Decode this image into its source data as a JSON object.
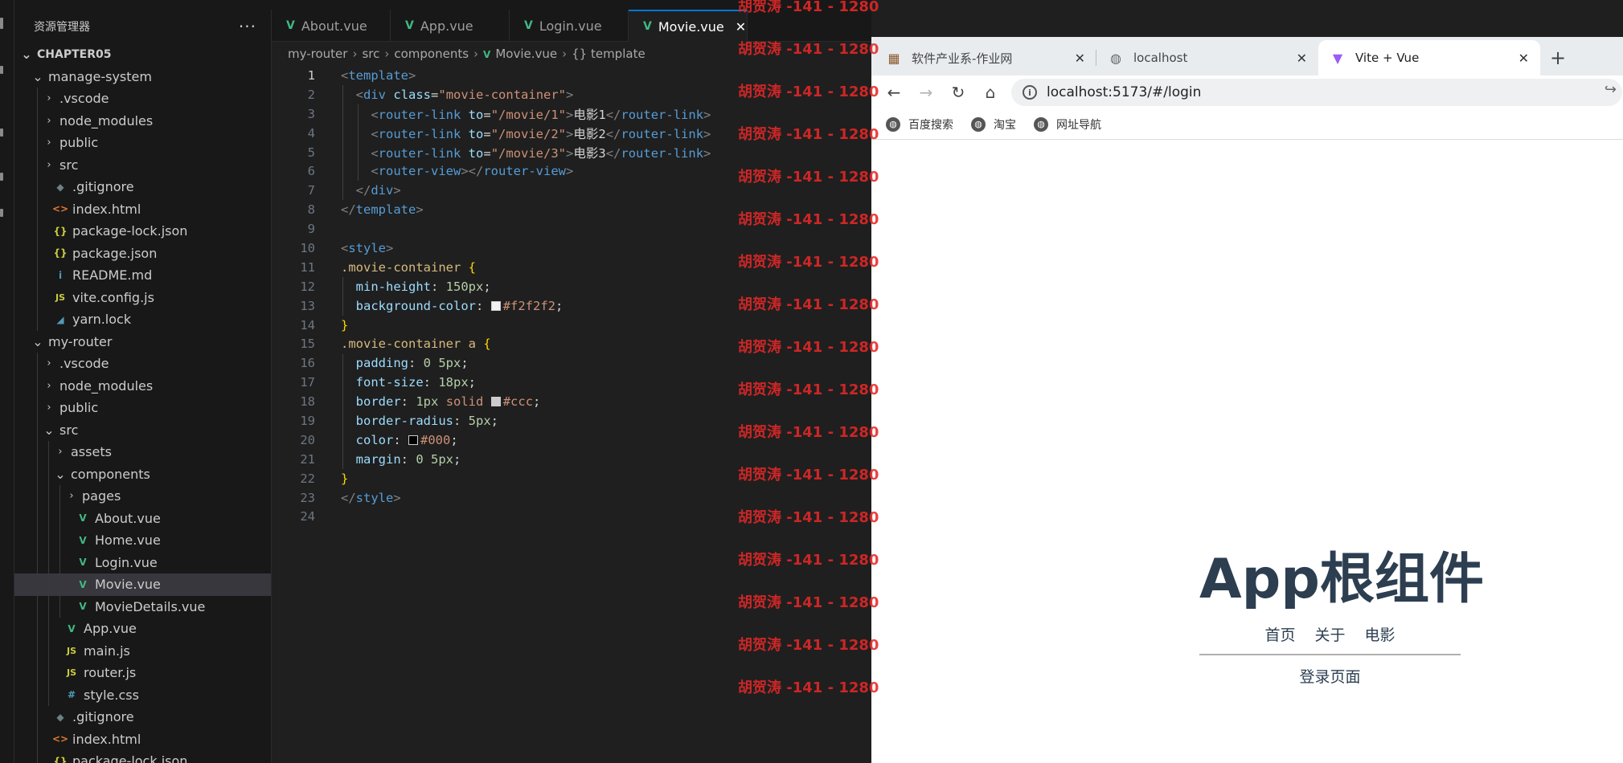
{
  "vscode": {
    "explorer_title": "资源管理器",
    "more_label": "···",
    "tree": [
      {
        "label": "CHAPTER05",
        "depth": 0,
        "kind": "folder-open",
        "icon": "",
        "bold": true
      },
      {
        "label": "manage-system",
        "depth": 1,
        "kind": "folder-open",
        "icon": ""
      },
      {
        "label": ".vscode",
        "depth": 2,
        "kind": "folder",
        "icon": ""
      },
      {
        "label": "node_modules",
        "depth": 2,
        "kind": "folder",
        "icon": ""
      },
      {
        "label": "public",
        "depth": 2,
        "kind": "folder",
        "icon": ""
      },
      {
        "label": "src",
        "depth": 2,
        "kind": "folder",
        "icon": ""
      },
      {
        "label": ".gitignore",
        "depth": 2,
        "kind": "file",
        "icon": "git"
      },
      {
        "label": "index.html",
        "depth": 2,
        "kind": "file",
        "icon": "html"
      },
      {
        "label": "package-lock.json",
        "depth": 2,
        "kind": "file",
        "icon": "json"
      },
      {
        "label": "package.json",
        "depth": 2,
        "kind": "file",
        "icon": "json"
      },
      {
        "label": "README.md",
        "depth": 2,
        "kind": "file",
        "icon": "info"
      },
      {
        "label": "vite.config.js",
        "depth": 2,
        "kind": "file",
        "icon": "js"
      },
      {
        "label": "yarn.lock",
        "depth": 2,
        "kind": "file",
        "icon": "yarn"
      },
      {
        "label": "my-router",
        "depth": 1,
        "kind": "folder-open",
        "icon": ""
      },
      {
        "label": ".vscode",
        "depth": 2,
        "kind": "folder",
        "icon": ""
      },
      {
        "label": "node_modules",
        "depth": 2,
        "kind": "folder",
        "icon": ""
      },
      {
        "label": "public",
        "depth": 2,
        "kind": "folder",
        "icon": ""
      },
      {
        "label": "src",
        "depth": 2,
        "kind": "folder-open",
        "icon": ""
      },
      {
        "label": "assets",
        "depth": 3,
        "kind": "folder",
        "icon": ""
      },
      {
        "label": "components",
        "depth": 3,
        "kind": "folder-open",
        "icon": ""
      },
      {
        "label": "pages",
        "depth": 4,
        "kind": "folder",
        "icon": ""
      },
      {
        "label": "About.vue",
        "depth": 4,
        "kind": "file",
        "icon": "vue"
      },
      {
        "label": "Home.vue",
        "depth": 4,
        "kind": "file",
        "icon": "vue"
      },
      {
        "label": "Login.vue",
        "depth": 4,
        "kind": "file",
        "icon": "vue"
      },
      {
        "label": "Movie.vue",
        "depth": 4,
        "kind": "file",
        "icon": "vue",
        "selected": true
      },
      {
        "label": "MovieDetails.vue",
        "depth": 4,
        "kind": "file",
        "icon": "vue"
      },
      {
        "label": "App.vue",
        "depth": 3,
        "kind": "file",
        "icon": "vue"
      },
      {
        "label": "main.js",
        "depth": 3,
        "kind": "file",
        "icon": "js"
      },
      {
        "label": "router.js",
        "depth": 3,
        "kind": "file",
        "icon": "js"
      },
      {
        "label": "style.css",
        "depth": 3,
        "kind": "file",
        "icon": "css"
      },
      {
        "label": ".gitignore",
        "depth": 2,
        "kind": "file",
        "icon": "git"
      },
      {
        "label": "index.html",
        "depth": 2,
        "kind": "file",
        "icon": "html"
      },
      {
        "label": "package-lock.json",
        "depth": 2,
        "kind": "file",
        "icon": "json"
      }
    ],
    "tabs": [
      {
        "label": "About.vue",
        "active": false
      },
      {
        "label": "App.vue",
        "active": false
      },
      {
        "label": "Login.vue",
        "active": false
      },
      {
        "label": "Movie.vue",
        "active": true
      }
    ],
    "tab_close": "✕",
    "breadcrumb": [
      "my-router",
      "src",
      "components",
      "Movie.vue",
      "{} template"
    ],
    "current_line": 1,
    "code": [
      [
        [
          "t-brk",
          "<"
        ],
        [
          "t-tag",
          "template"
        ],
        [
          "t-brk",
          ">"
        ]
      ],
      [
        [
          "",
          "  "
        ],
        [
          "t-brk",
          "<"
        ],
        [
          "t-tag",
          "div"
        ],
        [
          "",
          " "
        ],
        [
          "t-attr",
          "class"
        ],
        [
          "",
          "="
        ],
        [
          "t-str",
          "\"movie-container\""
        ],
        [
          "t-brk",
          ">"
        ]
      ],
      [
        [
          "",
          "    "
        ],
        [
          "t-brk",
          "<"
        ],
        [
          "t-tag",
          "router-link"
        ],
        [
          "",
          " "
        ],
        [
          "t-attr",
          "to"
        ],
        [
          "",
          "="
        ],
        [
          "t-str",
          "\"/movie/1\""
        ],
        [
          "t-brk",
          ">"
        ],
        [
          "",
          "电影1"
        ],
        [
          "t-brk",
          "</"
        ],
        [
          "t-tag",
          "router-link"
        ],
        [
          "t-brk",
          ">"
        ]
      ],
      [
        [
          "",
          "    "
        ],
        [
          "t-brk",
          "<"
        ],
        [
          "t-tag",
          "router-link"
        ],
        [
          "",
          " "
        ],
        [
          "t-attr",
          "to"
        ],
        [
          "",
          "="
        ],
        [
          "t-str",
          "\"/movie/2\""
        ],
        [
          "t-brk",
          ">"
        ],
        [
          "",
          "电影2"
        ],
        [
          "t-brk",
          "</"
        ],
        [
          "t-tag",
          "router-link"
        ],
        [
          "t-brk",
          ">"
        ]
      ],
      [
        [
          "",
          "    "
        ],
        [
          "t-brk",
          "<"
        ],
        [
          "t-tag",
          "router-link"
        ],
        [
          "",
          " "
        ],
        [
          "t-attr",
          "to"
        ],
        [
          "",
          "="
        ],
        [
          "t-str",
          "\"/movie/3\""
        ],
        [
          "t-brk",
          ">"
        ],
        [
          "",
          "电影3"
        ],
        [
          "t-brk",
          "</"
        ],
        [
          "t-tag",
          "router-link"
        ],
        [
          "t-brk",
          ">"
        ]
      ],
      [
        [
          "",
          "    "
        ],
        [
          "t-brk",
          "<"
        ],
        [
          "t-tag",
          "router-view"
        ],
        [
          "t-brk",
          "></"
        ],
        [
          "t-tag",
          "router-view"
        ],
        [
          "t-brk",
          ">"
        ]
      ],
      [
        [
          "",
          "  "
        ],
        [
          "t-brk",
          "</"
        ],
        [
          "t-tag",
          "div"
        ],
        [
          "t-brk",
          ">"
        ]
      ],
      [
        [
          "t-brk",
          "</"
        ],
        [
          "t-tag",
          "template"
        ],
        [
          "t-brk",
          ">"
        ]
      ],
      [],
      [
        [
          "t-brk",
          "<"
        ],
        [
          "t-tag",
          "style"
        ],
        [
          "t-brk",
          ">"
        ]
      ],
      [
        [
          "t-sel",
          ".movie-container"
        ],
        [
          "",
          " "
        ],
        [
          "t-brace",
          "{"
        ]
      ],
      [
        [
          "",
          "  "
        ],
        [
          "t-prop",
          "min-height"
        ],
        [
          "",
          ": "
        ],
        [
          "t-num",
          "150px"
        ],
        [
          "",
          ";"
        ]
      ],
      [
        [
          "",
          "  "
        ],
        [
          "t-prop",
          "background-color"
        ],
        [
          "",
          ": "
        ],
        [
          "swatch",
          "#f2f2f2"
        ],
        [
          "t-val",
          "#f2f2f2"
        ],
        [
          "",
          ";"
        ]
      ],
      [
        [
          "t-brace",
          "}"
        ]
      ],
      [
        [
          "t-sel",
          ".movie-container a"
        ],
        [
          "",
          " "
        ],
        [
          "t-brace",
          "{"
        ]
      ],
      [
        [
          "",
          "  "
        ],
        [
          "t-prop",
          "padding"
        ],
        [
          "",
          ": "
        ],
        [
          "t-num",
          "0 5px"
        ],
        [
          "",
          ";"
        ]
      ],
      [
        [
          "",
          "  "
        ],
        [
          "t-prop",
          "font-size"
        ],
        [
          "",
          ": "
        ],
        [
          "t-num",
          "18px"
        ],
        [
          "",
          ";"
        ]
      ],
      [
        [
          "",
          "  "
        ],
        [
          "t-prop",
          "border"
        ],
        [
          "",
          ": "
        ],
        [
          "t-num",
          "1px"
        ],
        [
          "",
          " "
        ],
        [
          "t-val",
          "solid"
        ],
        [
          "",
          " "
        ],
        [
          "swatch",
          "#cccccc"
        ],
        [
          "t-val",
          "#ccc"
        ],
        [
          "",
          ";"
        ]
      ],
      [
        [
          "",
          "  "
        ],
        [
          "t-prop",
          "border-radius"
        ],
        [
          "",
          ": "
        ],
        [
          "t-num",
          "5px"
        ],
        [
          "",
          ";"
        ]
      ],
      [
        [
          "",
          "  "
        ],
        [
          "t-prop",
          "color"
        ],
        [
          "",
          ": "
        ],
        [
          "swatch",
          "#000000"
        ],
        [
          "t-val",
          "#000"
        ],
        [
          "",
          ";"
        ]
      ],
      [
        [
          "",
          "  "
        ],
        [
          "t-prop",
          "margin"
        ],
        [
          "",
          ": "
        ],
        [
          "t-num",
          "0 5px"
        ],
        [
          "",
          ";"
        ]
      ],
      [
        [
          "t-brace",
          "}"
        ]
      ],
      [
        [
          "t-brk",
          "</"
        ],
        [
          "t-tag",
          "style"
        ],
        [
          "t-brk",
          ">"
        ]
      ],
      []
    ]
  },
  "watermark": {
    "text": "胡贺涛 -141 - 1280",
    "count": 17
  },
  "browser": {
    "tabs": [
      {
        "title": "软件产业系-作业网",
        "favicon": "site-icon",
        "active": false
      },
      {
        "title": "localhost",
        "favicon": "globe-icon",
        "active": false
      },
      {
        "title": "Vite + Vue",
        "favicon": "vite-icon",
        "active": true
      }
    ],
    "tab_close": "✕",
    "new_tab": "+",
    "url": "localhost:5173/#/login",
    "bookmarks": [
      "百度搜索",
      "淘宝",
      "网址导航"
    ],
    "page": {
      "title": "App根组件",
      "nav": [
        "首页",
        "关于",
        "电影"
      ],
      "route_view": "登录页面"
    }
  },
  "colors": {
    "editor_bg": "#1f1f1f",
    "sidebar_bg": "#181818",
    "accent": "#0078d4",
    "vue_green": "#41b883",
    "watermark": "#e62828",
    "app_text": "#2c3e50"
  }
}
